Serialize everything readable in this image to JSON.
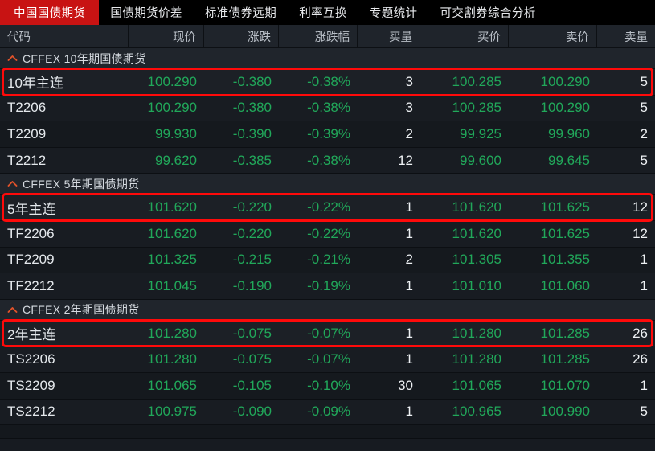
{
  "nav": {
    "tabs": [
      {
        "label": "中国国债期货",
        "active": true
      },
      {
        "label": "国债期货价差",
        "active": false
      },
      {
        "label": "标准债券远期",
        "active": false
      },
      {
        "label": "利率互换",
        "active": false
      },
      {
        "label": "专题统计",
        "active": false
      },
      {
        "label": "可交割券综合分析",
        "active": false
      }
    ]
  },
  "colors": {
    "accent_red": "#c81313",
    "highlight_red": "#ff0a0a",
    "down_green": "#21a85a",
    "text_white": "#eef1f4",
    "chevron_orange": "#e0522a",
    "background": "#14181d",
    "header_bg": "#1f242b"
  },
  "columns": [
    {
      "key": "code",
      "label": "代码"
    },
    {
      "key": "last",
      "label": "现价"
    },
    {
      "key": "change",
      "label": "涨跌"
    },
    {
      "key": "pct",
      "label": "涨跌幅"
    },
    {
      "key": "bid_vol",
      "label": "买量"
    },
    {
      "key": "bid",
      "label": "买价"
    },
    {
      "key": "ask",
      "label": "卖价"
    },
    {
      "key": "ask_vol",
      "label": "卖量"
    }
  ],
  "groups": [
    {
      "label": "CFFEX 10年期国债期货",
      "icon": "chevron-up-icon",
      "expanded": true,
      "rows": [
        {
          "code": "10年主连",
          "last": "100.290",
          "change": "-0.380",
          "pct": "-0.38%",
          "bid_vol": "3",
          "bid": "100.285",
          "ask": "100.290",
          "ask_vol": "5",
          "highlighted": true
        },
        {
          "code": "T2206",
          "last": "100.290",
          "change": "-0.380",
          "pct": "-0.38%",
          "bid_vol": "3",
          "bid": "100.285",
          "ask": "100.290",
          "ask_vol": "5",
          "highlighted": false
        },
        {
          "code": "T2209",
          "last": "99.930",
          "change": "-0.390",
          "pct": "-0.39%",
          "bid_vol": "2",
          "bid": "99.925",
          "ask": "99.960",
          "ask_vol": "2",
          "highlighted": false
        },
        {
          "code": "T2212",
          "last": "99.620",
          "change": "-0.385",
          "pct": "-0.38%",
          "bid_vol": "12",
          "bid": "99.600",
          "ask": "99.645",
          "ask_vol": "5",
          "highlighted": false
        }
      ]
    },
    {
      "label": "CFFEX 5年期国债期货",
      "icon": "chevron-up-icon",
      "expanded": true,
      "rows": [
        {
          "code": "5年主连",
          "last": "101.620",
          "change": "-0.220",
          "pct": "-0.22%",
          "bid_vol": "1",
          "bid": "101.620",
          "ask": "101.625",
          "ask_vol": "12",
          "highlighted": true
        },
        {
          "code": "TF2206",
          "last": "101.620",
          "change": "-0.220",
          "pct": "-0.22%",
          "bid_vol": "1",
          "bid": "101.620",
          "ask": "101.625",
          "ask_vol": "12",
          "highlighted": false
        },
        {
          "code": "TF2209",
          "last": "101.325",
          "change": "-0.215",
          "pct": "-0.21%",
          "bid_vol": "2",
          "bid": "101.305",
          "ask": "101.355",
          "ask_vol": "1",
          "highlighted": false
        },
        {
          "code": "TF2212",
          "last": "101.045",
          "change": "-0.190",
          "pct": "-0.19%",
          "bid_vol": "1",
          "bid": "101.010",
          "ask": "101.060",
          "ask_vol": "1",
          "highlighted": false
        }
      ]
    },
    {
      "label": "CFFEX 2年期国债期货",
      "icon": "chevron-up-icon",
      "expanded": true,
      "rows": [
        {
          "code": "2年主连",
          "last": "101.280",
          "change": "-0.075",
          "pct": "-0.07%",
          "bid_vol": "1",
          "bid": "101.280",
          "ask": "101.285",
          "ask_vol": "26",
          "highlighted": true
        },
        {
          "code": "TS2206",
          "last": "101.280",
          "change": "-0.075",
          "pct": "-0.07%",
          "bid_vol": "1",
          "bid": "101.280",
          "ask": "101.285",
          "ask_vol": "26",
          "highlighted": false
        },
        {
          "code": "TS2209",
          "last": "101.065",
          "change": "-0.105",
          "pct": "-0.10%",
          "bid_vol": "30",
          "bid": "101.065",
          "ask": "101.070",
          "ask_vol": "1",
          "highlighted": false
        },
        {
          "code": "TS2212",
          "last": "100.975",
          "change": "-0.090",
          "pct": "-0.09%",
          "bid_vol": "1",
          "bid": "100.965",
          "ask": "100.990",
          "ask_vol": "5",
          "highlighted": false
        }
      ]
    }
  ]
}
